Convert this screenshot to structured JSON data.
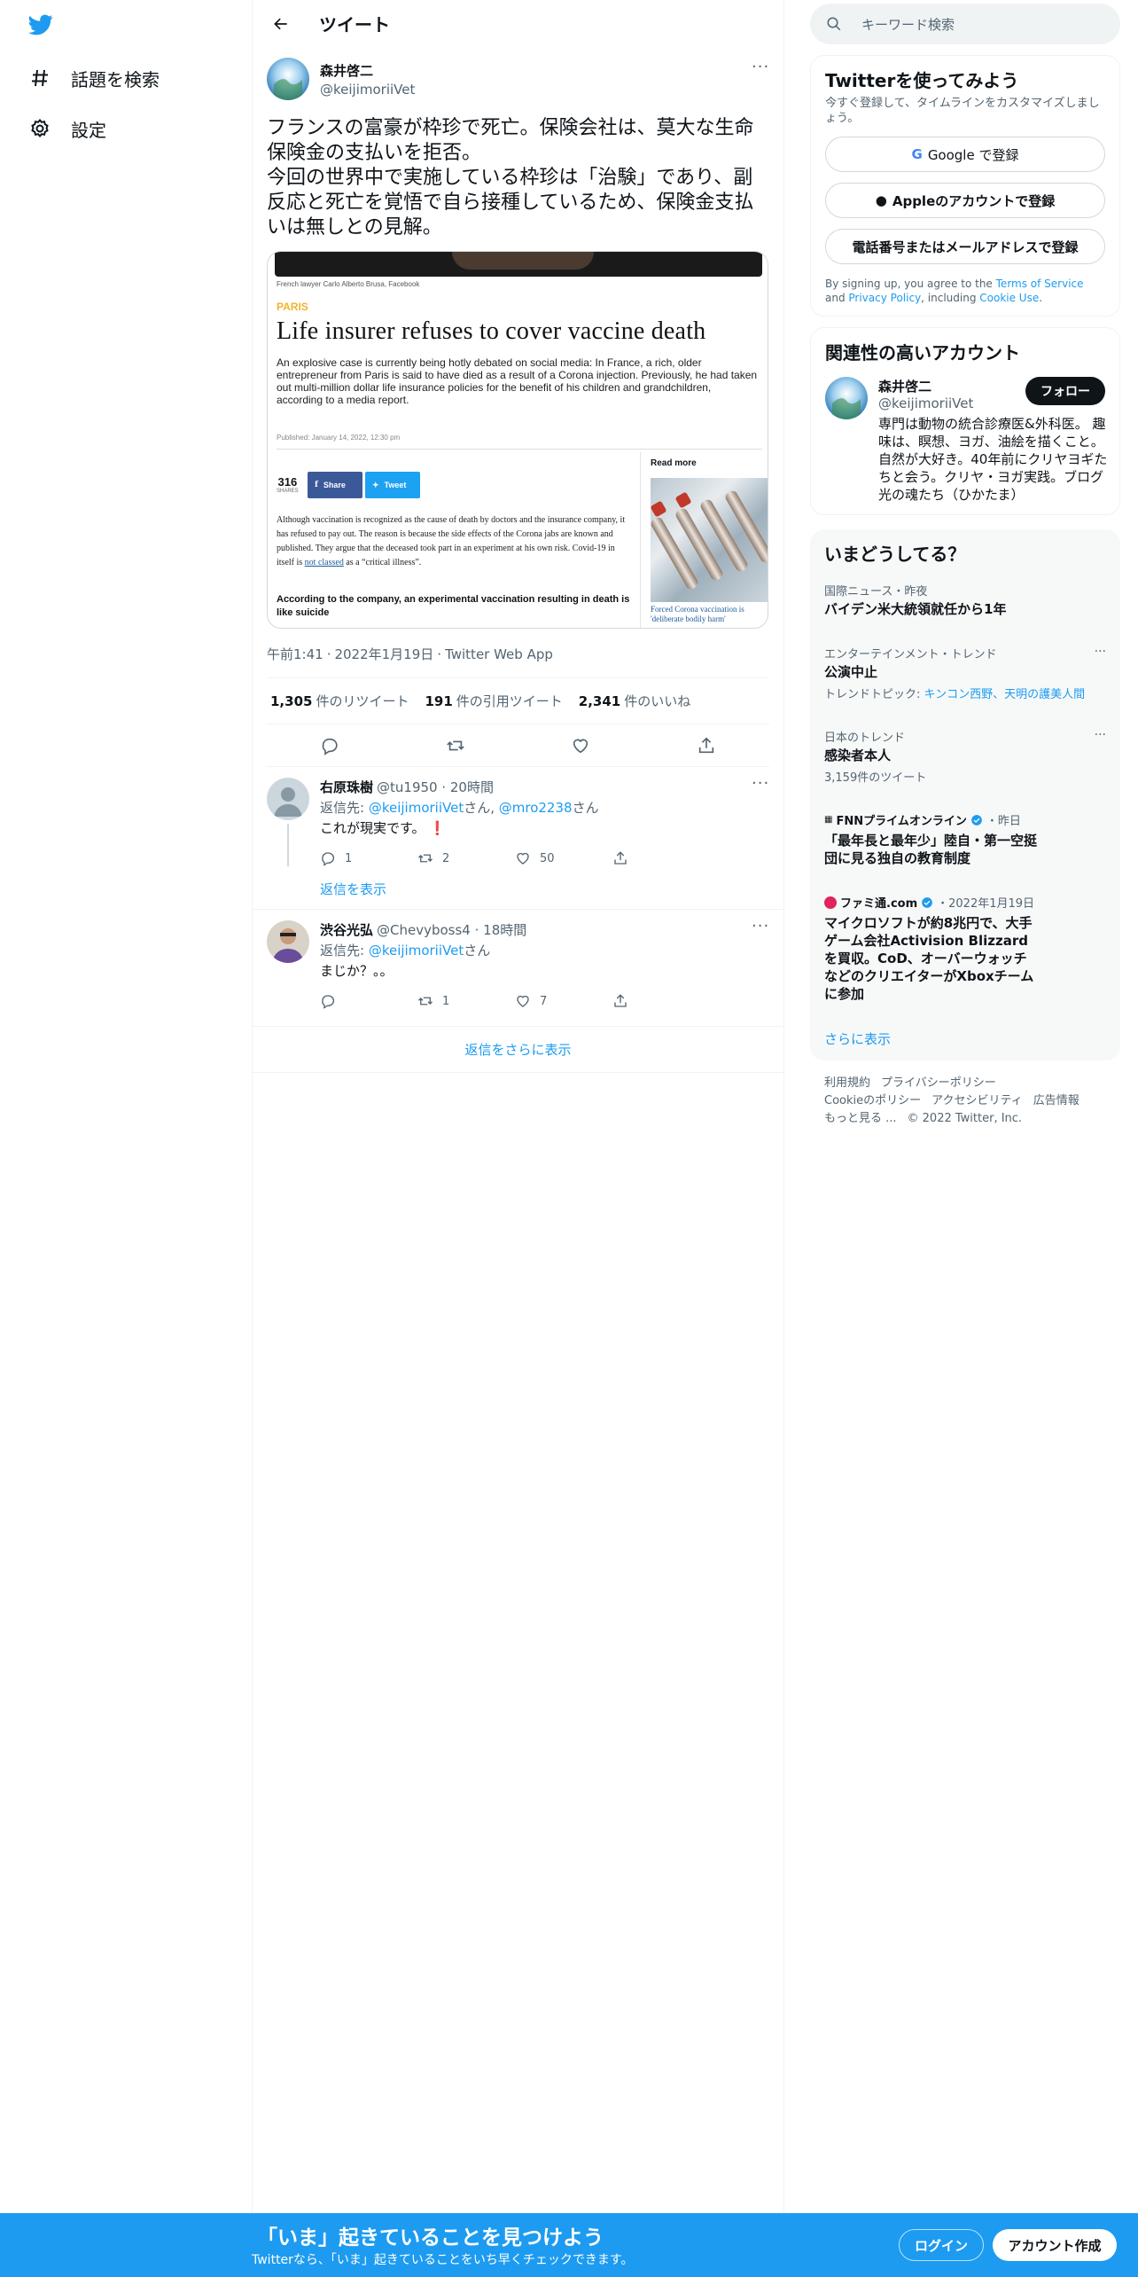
{
  "nav": {
    "explore_label": "話題を検索",
    "settings_label": "設定"
  },
  "header": {
    "title": "ツイート"
  },
  "tweet": {
    "author_name": "森井啓二",
    "author_handle": "@keijimoriiVet",
    "text": "フランスの富豪が枠珍で死亡。保険会社は、莫大な生命保険金の支払いを拒否。\n今回の世界中で実施している枠珍は「治験」であり、副反応と死亡を覚悟で自ら接種しているため、保険金支払いは無しとの見解。",
    "media": {
      "caption": "French lawyer Carlo Alberto Brusa, Facebook",
      "section": "PARIS",
      "headline": "Life insurer refuses to cover vaccine death",
      "lead": "An explosive case is currently being hotly debated on social media: In France, a rich, older entrepreneur from Paris is said to have died as a result of a Corona injection. Previously, he had taken out multi-million dollar life insurance policies for the benefit of his children and grandchildren, according to a media report.",
      "published": "Published: January 14, 2022, 12:30 pm",
      "shares_count": "316",
      "shares_label": "SHARES",
      "share_button": "Share",
      "tweet_button": "Tweet",
      "body": "Although vaccination is recognized as the cause of death by doctors and the insurance company, it has refused to pay out. The reason is because the side effects of the Corona jabs are known and published. They argue that the deceased took part in an experiment at his own risk. Covid-19 in itself is",
      "body_link": "not classed",
      "body_tail": "as a “critical illness”.",
      "subhead": "According to the company, an experimental vaccination resulting in death is like suicide",
      "read_more": "Read more",
      "thumb_caption": "Forced Corona vaccination is 'deliberate bodily harm'"
    },
    "time": "午前1:41",
    "date": "2022年1月19日",
    "source": "Twitter Web App",
    "retweets": "1,305",
    "retweets_label": "件のリツイート",
    "quotes": "191",
    "quotes_label": "件の引用ツイート",
    "likes": "2,341",
    "likes_label": "件のいいね"
  },
  "replies": [
    {
      "name": "右原珠樹",
      "handle": "@tu1950",
      "time": "20時間",
      "reply_prefix": "返信先: ",
      "to1": "@keijimoriiVet",
      "san1": "さん, ",
      "to2": "@mro2238",
      "san2": "さん",
      "text": "これが現実です。",
      "emoji": "❗",
      "reply_count": "1",
      "retweet_count": "2",
      "like_count": "50",
      "show_replies": "返信を表示"
    },
    {
      "name": "渋谷光弘",
      "handle": "@Chevyboss4",
      "time": "18時間",
      "reply_prefix": "返信先: ",
      "to1": "@keijimoriiVet",
      "san1": "さん",
      "text": "まじか？。。",
      "reply_count": "",
      "retweet_count": "1",
      "like_count": "7"
    }
  ],
  "show_more_replies": "返信をさらに表示",
  "search": {
    "placeholder": "キーワード検索"
  },
  "signup_card": {
    "title": "Twitterを使ってみよう",
    "subtitle": "今すぐ登録して、タイムラインをカスタマイズしましょう。",
    "google_label": "Google で登録",
    "apple_label": "Appleのアカウントで登録",
    "phone_label": "電話番号またはメールアドレスで登録",
    "legal_1": "By signing up, you agree to the ",
    "tos": "Terms of Service",
    "legal_2": " and ",
    "privacy": "Privacy Policy",
    "legal_3": ", including ",
    "cookie": "Cookie Use",
    "legal_4": "."
  },
  "related": {
    "title": "関連性の高いアカウント",
    "name": "森井啓二",
    "handle": "@keijimoriiVet",
    "follow": "フォロー",
    "bio": "専門は動物の統合診療医&外科医。 趣味は、瞑想、ヨガ、油絵を描くこと。自然が大好き。40年前にクリヤヨギたちと会う。クリヤ・ヨガ実践。ブログ 光の魂たち（ひかたま）"
  },
  "trends": {
    "title": "いまどうしてる？",
    "items": [
      {
        "context": "国際ニュース・昨夜",
        "name": "バイデン米大統領就任から1年"
      },
      {
        "context": "エンターテインメント・トレンド",
        "name": "公演中止",
        "extra_prefix": "トレンドトピック: ",
        "extra_link": "キンコン西野、天明の護美人間"
      },
      {
        "context": "日本のトレンド",
        "name": "感染者本人",
        "extra": "3,159件のツイート"
      }
    ],
    "news": [
      {
        "source": "FNNプライムオンライン",
        "time": "・昨日",
        "headline": "「最年長と最年少」陸自・第一空挺団に見る独自の教育制度"
      },
      {
        "source": "ファミ通.com",
        "time": "・2022年1月19日",
        "headline": "マイクロソフトが約8兆円で、大手ゲーム会社Activision Blizzardを買収。CoD、オーバーウォッチなどのクリエイターがXboxチームに参加"
      }
    ],
    "show_more": "さらに表示"
  },
  "footer": {
    "terms": "利用規約",
    "privacy": "プライバシーポリシー",
    "cookie": "Cookieのポリシー",
    "accessibility": "アクセシビリティ",
    "ads": "広告情報",
    "more": "もっと見る ...",
    "copyright": "© 2022 Twitter, Inc."
  },
  "bottombar": {
    "title": "「いま」起きていることを見つけよう",
    "subtitle": "Twitterなら、「いま」起きていることをいち早くチェックできます。",
    "login": "ログイン",
    "signup": "アカウント作成"
  },
  "colors": {
    "accent": "#1d9bf0",
    "text": "#0f1419",
    "muted": "#536471"
  }
}
